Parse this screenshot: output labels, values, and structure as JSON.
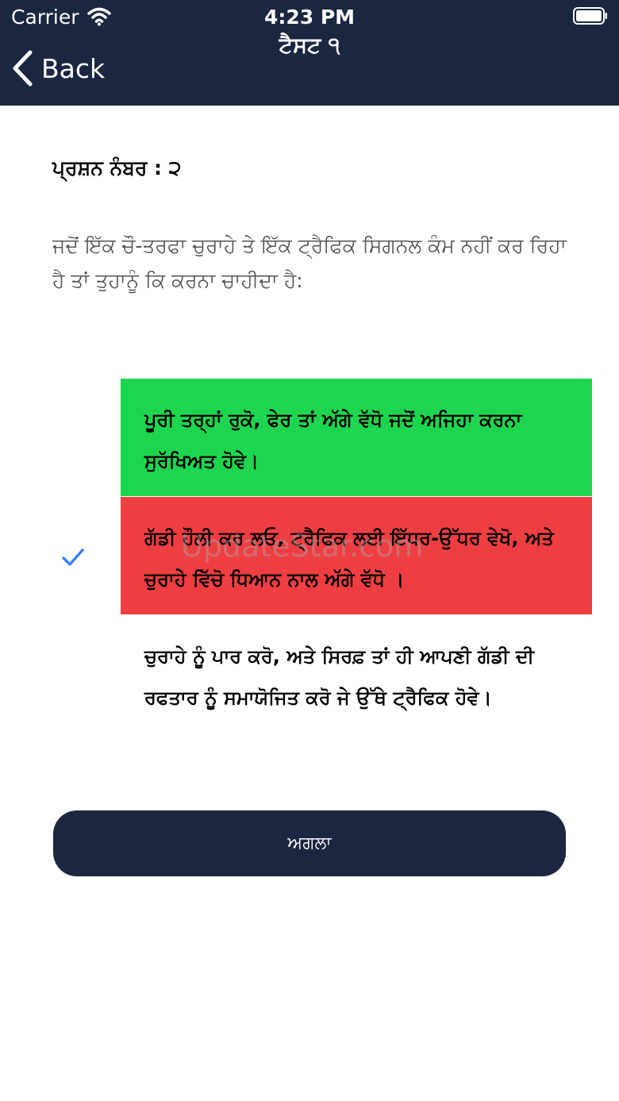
{
  "status_bar": {
    "carrier": "Carrier",
    "time": "4:23 PM",
    "wifi_icon": "wifi-icon",
    "battery_icon": "battery-full-icon"
  },
  "nav": {
    "title": "ਟੈਸਟ ੧",
    "back_label": "Back",
    "back_icon": "chevron-left-icon"
  },
  "question": {
    "number_label": "ਪ੍ਰਸ਼ਨ ਨੰਬਰ : ੨",
    "text": "ਜਦੋਂ ਇੱਕ ਚੌ-ਤਰਫਾ ਚੁਰਾਹੇ ਤੇ ਇੱਕ ਟ੍ਰੈਫਿਕ ਸਿਗਨਲ ਕੰਮ ਨਹੀਂ ਕਰ ਰਿਹਾ ਹੈ ਤਾਂ ਤੁਹਾਨੂੰ ਕਿ ਕਰਨਾ ਚਾਹੀਦਾ ਹੈ:"
  },
  "options": [
    {
      "text": "ਪੂਰੀ ਤਰ੍ਹਾਂ ਰੁਕੋ, ਫੇਰ ਤਾਂ ਅੱਗੇ ਵੱਧੋ ਜਦੋਂ ਅਜਿਹਾ ਕਰਨਾ ਸੁਰੱਖਿਅਤ ਹੋਵੇ।",
      "state": "correct",
      "color": "#1ed54f"
    },
    {
      "text": "ਗੱਡੀ ਹੌਲੀ ਕਰ ਲਓ, ਟ੍ਰੈਫਿਕ ਲਈ ਇੱਧਰ-ਉੱਧਰ ਵੇਖੋ, ਅਤੇ ਚੁਰਾਹੇ ਵਿੱਚੋ ਧਿਆਨ ਨਾਲ ਅੱਗੇ ਵੱਧੋ ।",
      "state": "selected-wrong",
      "color": "#ef3e42",
      "selected": true
    },
    {
      "text": "ਚੁਰਾਹੇ ਨੂੰ ਪਾਰ ਕਰੋ, ਅਤੇ ਸਿਰਫ਼ ਤਾਂ ਹੀ ਆਪਣੀ ਗੱਡੀ ਦੀ ਰਫਤਾਰ ਨੂੰ ਸਮਾਯੋਜਿਤ ਕਰੋ ਜੇ ਉੱਥੇ ਟ੍ਰੈਫਿਕ ਹੋਵੇ।",
      "state": "neutral",
      "color": "#ffffff"
    }
  ],
  "selected_icon": "checkmark-icon",
  "watermark": "UpdateStar.com",
  "next_button": {
    "label": "ਅਗਲਾ"
  },
  "colors": {
    "nav_background": "#1b2640",
    "correct": "#1ed54f",
    "wrong": "#ef3e42",
    "checkmark": "#3b82f6",
    "question_text": "#555555"
  }
}
